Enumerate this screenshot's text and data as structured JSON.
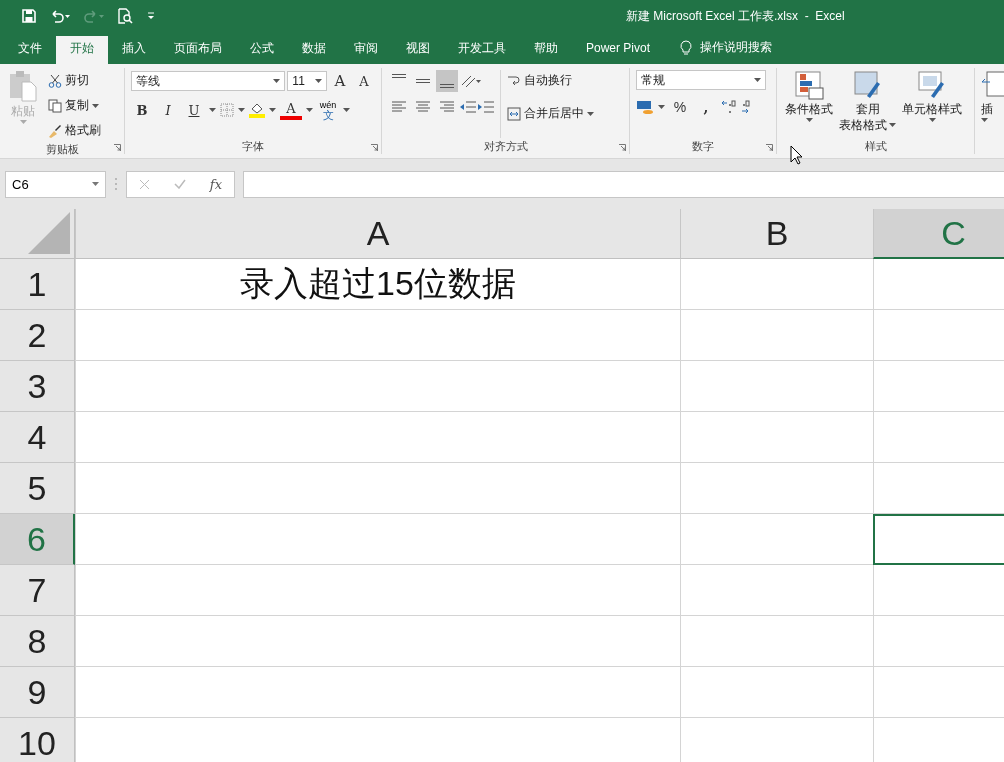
{
  "window": {
    "title": "新建 Microsoft Excel 工作表.xlsx  -  Excel"
  },
  "tabs": [
    {
      "label": "文件",
      "selected": false
    },
    {
      "label": "开始",
      "selected": true
    },
    {
      "label": "插入",
      "selected": false
    },
    {
      "label": "页面布局",
      "selected": false
    },
    {
      "label": "公式",
      "selected": false
    },
    {
      "label": "数据",
      "selected": false
    },
    {
      "label": "审阅",
      "selected": false
    },
    {
      "label": "视图",
      "selected": false
    },
    {
      "label": "开发工具",
      "selected": false
    },
    {
      "label": "帮助",
      "selected": false
    },
    {
      "label": "Power Pivot",
      "selected": false
    }
  ],
  "tell_me": {
    "placeholder": "操作说明搜索"
  },
  "ribbon": {
    "clipboard": {
      "label": "剪贴板",
      "paste": "粘贴",
      "cut": "剪切",
      "copy": "复制",
      "format_painter": "格式刷"
    },
    "font": {
      "label": "字体",
      "font_name": "等线",
      "font_size": "11",
      "grow": "A",
      "shrink": "A",
      "bold": "B",
      "italic": "I",
      "underline": "U",
      "font_color": "A",
      "phonetic_top": "wén",
      "phonetic_bottom": "文"
    },
    "alignment": {
      "label": "对齐方式",
      "vertical": [
        {
          "selected": false
        },
        {
          "selected": false
        },
        {
          "selected": true
        }
      ],
      "wrap_text": "自动换行",
      "merge_center": "合并后居中"
    },
    "number": {
      "label": "数字",
      "format": "常规",
      "percent": "%",
      "comma": ","
    },
    "styles": {
      "label": "样式",
      "conditional": "条件格式",
      "table_top": "套用",
      "table_bottom": "表格格式",
      "cell_styles": "单元格样式"
    },
    "cells": {
      "insert": "插"
    }
  },
  "formula_bar": {
    "name_box": "C6",
    "fx": "fx"
  },
  "sheet": {
    "columns": [
      {
        "label": "A",
        "selected": false
      },
      {
        "label": "B",
        "selected": false
      },
      {
        "label": "C",
        "selected": true
      }
    ],
    "rows": [
      {
        "label": "1",
        "selected": false,
        "cell_a": "录入超过15位数据"
      },
      {
        "label": "2",
        "selected": false
      },
      {
        "label": "3",
        "selected": false
      },
      {
        "label": "4",
        "selected": false
      },
      {
        "label": "5",
        "selected": false
      },
      {
        "label": "6",
        "selected": true
      },
      {
        "label": "7",
        "selected": false
      },
      {
        "label": "8",
        "selected": false
      },
      {
        "label": "9",
        "selected": false
      },
      {
        "label": "10",
        "selected": false
      }
    ]
  }
}
